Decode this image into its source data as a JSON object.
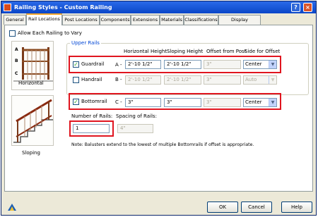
{
  "window": {
    "title": "Railing Styles - Custom Railing",
    "help_button": "?",
    "close_button": "×"
  },
  "tabs": [
    "General",
    "Rail Locations",
    "Post Locations",
    "Components",
    "Extensions",
    "Materials",
    "Classifications",
    "Display Properties"
  ],
  "allow_each_railing": {
    "label": "Allow Each Railing to Vary",
    "checked": false
  },
  "thumbnails": {
    "horizontal_caption": "Horizontal",
    "sloping_caption": "Sloping",
    "labels": [
      "A",
      "B",
      "C"
    ]
  },
  "upper_rails": {
    "group_label": "Upper Rails",
    "headers": {
      "horizontal_height": "Horizontal Height",
      "sloping_height": "Sloping Height",
      "offset_from_post": "Offset from Post",
      "side_for_offset": "Side for Offset"
    },
    "guardrail": {
      "label": "Guardrail",
      "checked": true,
      "letter": "A -",
      "horizontal_height": "2'-10 1/2\"",
      "sloping_height": "2'-10 1/2\"",
      "offset": "3\"",
      "side": "Center"
    },
    "handrail": {
      "label": "Handrail",
      "checked": false,
      "letter": "B -",
      "horizontal_height": "2'-10 1/2\"",
      "sloping_height": "2'-10 1/2\"",
      "offset": "3\"",
      "side": "Auto"
    }
  },
  "bottomrail": {
    "label": "Bottomrail",
    "checked": true,
    "letter": "C -",
    "horizontal_height": "3\"",
    "sloping_height": "3\"",
    "offset": "3\"",
    "side": "Center"
  },
  "number_of_rails": {
    "label": "Number of Rails:",
    "value": "1"
  },
  "spacing_of_rails": {
    "label": "Spacing of Rails:",
    "value": "4\""
  },
  "note": "Note: Balusters extend to the lowest of multiple Bottomrails if offset is appropriate.",
  "buttons": {
    "ok": "OK",
    "cancel": "Cancel",
    "help": "Help"
  },
  "colors": {
    "highlight": "#e0151f",
    "title_bar": "#0a46c8",
    "group_label": "#0046d5"
  }
}
